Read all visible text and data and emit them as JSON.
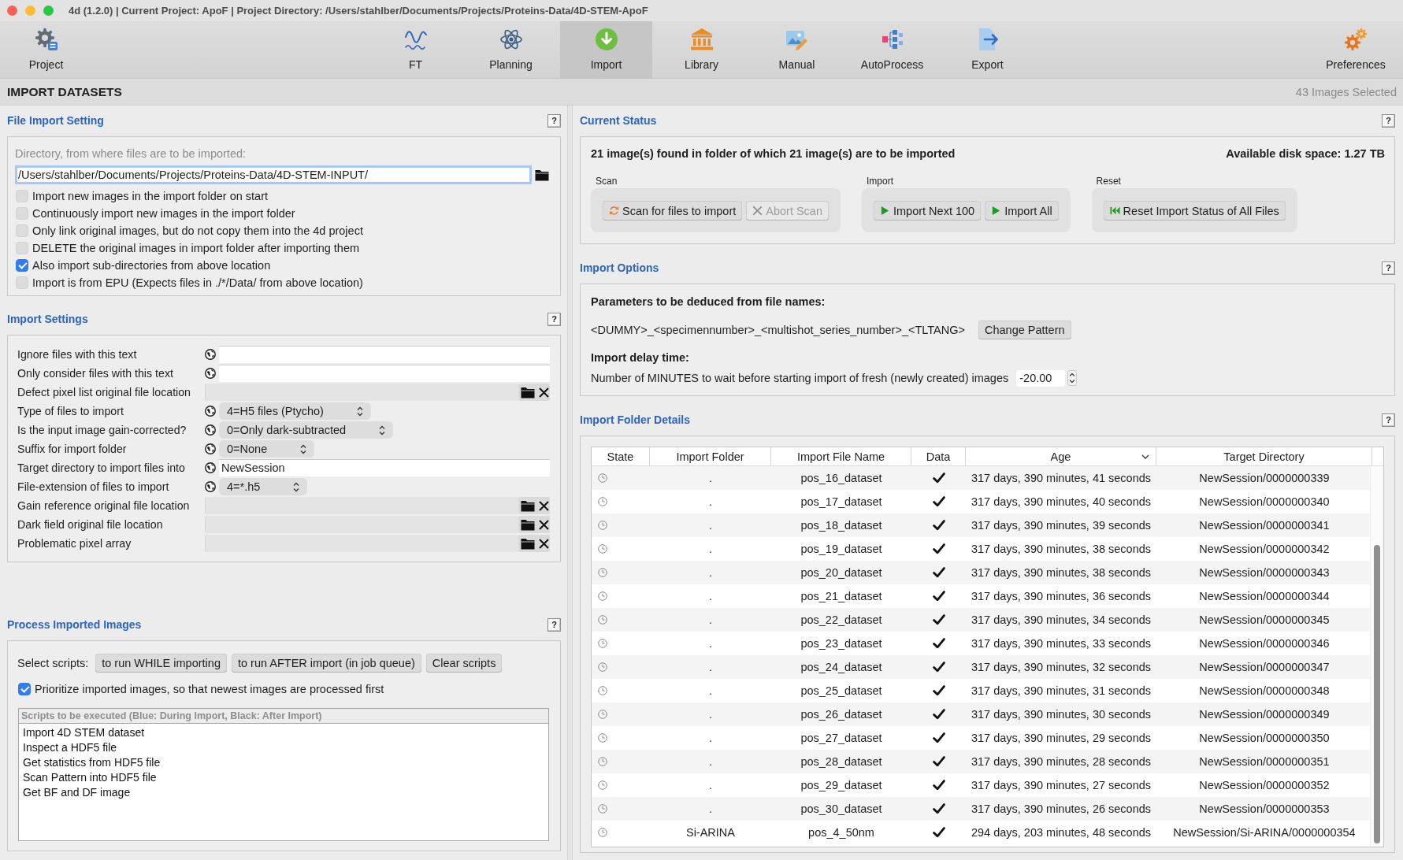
{
  "window": {
    "title": "4d (1.2.0) | Current Project: ApoF | Project Directory: /Users/stahlber/Documents/Projects/Proteins-Data/4D-STEM-ApoF"
  },
  "toolbar": {
    "start": [
      {
        "label": "Project",
        "selected": false
      }
    ],
    "center": [
      {
        "label": "FT",
        "selected": false
      },
      {
        "label": "Planning",
        "selected": false
      },
      {
        "label": "Import",
        "selected": true
      },
      {
        "label": "Library",
        "selected": false
      },
      {
        "label": "Manual",
        "selected": false
      },
      {
        "label": "AutoProcess",
        "selected": false
      },
      {
        "label": "Export",
        "selected": false
      }
    ],
    "end": [
      {
        "label": "Preferences",
        "selected": false
      }
    ]
  },
  "page_header": {
    "title": "IMPORT DATASETS",
    "selection_count": "43 Images Selected"
  },
  "file_import_setting": {
    "title": "File Import Setting",
    "help": "?",
    "directory_label": "Directory, from where files are to be imported:",
    "directory": {
      "value": "/Users/stahlber/Documents/Projects/Proteins-Data/4D-STEM-INPUT/",
      "focused": true
    },
    "options": [
      {
        "label": "Import new images in the import folder on start",
        "checked": false
      },
      {
        "label": "Continuously import new images in the import folder",
        "checked": false
      },
      {
        "label": "Only link original images, but do not copy them into the 4d project",
        "checked": false
      },
      {
        "label": "DELETE the original images in import folder after importing them",
        "checked": false
      },
      {
        "label": "Also import sub-directories from above location",
        "checked": true
      },
      {
        "label": "Import is from EPU (Expects files in ./*/Data/ from above location)",
        "checked": false
      }
    ]
  },
  "import_settings": {
    "title": "Import Settings",
    "help": "?",
    "rows": [
      {
        "label": "Ignore files with this text",
        "kind": "text"
      },
      {
        "label": "Only consider files with this text",
        "kind": "text"
      },
      {
        "label": "Defect pixel list original file location",
        "kind": "file"
      },
      {
        "label": "Type of files to import",
        "kind": "dropdown",
        "value": "4=H5 files (Ptycho)"
      },
      {
        "label": "Is the input image gain-corrected?",
        "kind": "dropdown",
        "value": "0=Only dark-subtracted"
      },
      {
        "label": "Suffix for import folder",
        "kind": "dropdown",
        "value": "0=None"
      },
      {
        "label": "Target directory to import files into",
        "kind": "text",
        "value": "NewSession"
      },
      {
        "label": "File-extension of files to import",
        "kind": "dropdown",
        "value": "4=*.h5"
      },
      {
        "label": "Gain reference original file location",
        "kind": "file"
      },
      {
        "label": "Dark field original file location",
        "kind": "file"
      },
      {
        "label": "Problematic pixel array",
        "kind": "file"
      }
    ]
  },
  "process_imported_images": {
    "title": "Process Imported Images",
    "help": "?",
    "select_label": "Select scripts:",
    "buttons": [
      "to run WHILE importing",
      "to run AFTER import (in job queue)",
      "Clear scripts"
    ],
    "prioritize": {
      "label": "Prioritize imported images, so that newest images are processed first",
      "checked": true
    },
    "scripts_header": "Scripts to be executed (Blue: During Import, Black: After Import)",
    "scripts": [
      {
        "name": "Import 4D STEM dataset",
        "during_import": false
      },
      {
        "name": "Inspect a HDF5 file",
        "during_import": false
      },
      {
        "name": "Get statistics from HDF5 file",
        "during_import": false
      },
      {
        "name": "Scan Pattern into HDF5 file",
        "during_import": false
      },
      {
        "name": "Get BF and DF image",
        "during_import": false
      }
    ]
  },
  "current_status": {
    "title": "Current Status",
    "help": "?",
    "summary": "21 image(s) found in folder of which 21 image(s) are to be imported",
    "disk_space": "Available disk space: 1.27 TB",
    "groups": [
      {
        "label": "Scan",
        "buttons": [
          {
            "label": "Scan for files to import",
            "kind": "scan",
            "disabled": false
          },
          {
            "label": "Abort Scan",
            "kind": "abort",
            "disabled": true
          }
        ]
      },
      {
        "label": "Import",
        "buttons": [
          {
            "label": "Import Next 100",
            "kind": "import",
            "disabled": false
          },
          {
            "label": "Import All",
            "kind": "import",
            "disabled": false
          }
        ]
      },
      {
        "label": "Reset",
        "buttons": [
          {
            "label": "Reset Import Status of All Files",
            "kind": "reset",
            "disabled": false
          }
        ]
      }
    ]
  },
  "import_options": {
    "title": "Import Options",
    "help": "?",
    "pattern_heading": "Parameters to be deduced from file names:",
    "pattern": "<DUMMY>_<specimennumber>_<multishot_series_number>_<TLTANG>",
    "change_pattern_button": "Change Pattern",
    "delay_heading": "Import delay time:",
    "delay_label": "Number of MINUTES to wait before starting import of fresh (newly created) images",
    "delay_value": "-20.00"
  },
  "import_folder_details": {
    "title": "Import Folder Details",
    "help": "?",
    "table": {
      "columns": [
        {
          "label": "State",
          "sorted": false
        },
        {
          "label": "Import Folder",
          "sorted": false
        },
        {
          "label": "Import File Name",
          "sorted": false
        },
        {
          "label": "Data",
          "sorted": false
        },
        {
          "label": "Age",
          "sorted": true
        },
        {
          "label": "Target Directory",
          "sorted": false
        }
      ],
      "rows": [
        {
          "import_folder": ".",
          "file_name": "pos_16_dataset",
          "data": true,
          "age": "317 days, 390 minutes, 41 seconds",
          "target_directory": "NewSession/0000000339"
        },
        {
          "import_folder": ".",
          "file_name": "pos_17_dataset",
          "data": true,
          "age": "317 days, 390 minutes, 40 seconds",
          "target_directory": "NewSession/0000000340"
        },
        {
          "import_folder": ".",
          "file_name": "pos_18_dataset",
          "data": true,
          "age": "317 days, 390 minutes, 39 seconds",
          "target_directory": "NewSession/0000000341"
        },
        {
          "import_folder": ".",
          "file_name": "pos_19_dataset",
          "data": true,
          "age": "317 days, 390 minutes, 38 seconds",
          "target_directory": "NewSession/0000000342"
        },
        {
          "import_folder": ".",
          "file_name": "pos_20_dataset",
          "data": true,
          "age": "317 days, 390 minutes, 38 seconds",
          "target_directory": "NewSession/0000000343"
        },
        {
          "import_folder": ".",
          "file_name": "pos_21_dataset",
          "data": true,
          "age": "317 days, 390 minutes, 36 seconds",
          "target_directory": "NewSession/0000000344"
        },
        {
          "import_folder": ".",
          "file_name": "pos_22_dataset",
          "data": true,
          "age": "317 days, 390 minutes, 34 seconds",
          "target_directory": "NewSession/0000000345"
        },
        {
          "import_folder": ".",
          "file_name": "pos_23_dataset",
          "data": true,
          "age": "317 days, 390 minutes, 33 seconds",
          "target_directory": "NewSession/0000000346"
        },
        {
          "import_folder": ".",
          "file_name": "pos_24_dataset",
          "data": true,
          "age": "317 days, 390 minutes, 32 seconds",
          "target_directory": "NewSession/0000000347"
        },
        {
          "import_folder": ".",
          "file_name": "pos_25_dataset",
          "data": true,
          "age": "317 days, 390 minutes, 31 seconds",
          "target_directory": "NewSession/0000000348"
        },
        {
          "import_folder": ".",
          "file_name": "pos_26_dataset",
          "data": true,
          "age": "317 days, 390 minutes, 30 seconds",
          "target_directory": "NewSession/0000000349"
        },
        {
          "import_folder": ".",
          "file_name": "pos_27_dataset",
          "data": true,
          "age": "317 days, 390 minutes, 29 seconds",
          "target_directory": "NewSession/0000000350"
        },
        {
          "import_folder": ".",
          "file_name": "pos_28_dataset",
          "data": true,
          "age": "317 days, 390 minutes, 28 seconds",
          "target_directory": "NewSession/0000000351"
        },
        {
          "import_folder": ".",
          "file_name": "pos_29_dataset",
          "data": true,
          "age": "317 days, 390 minutes, 27 seconds",
          "target_directory": "NewSession/0000000352"
        },
        {
          "import_folder": ".",
          "file_name": "pos_30_dataset",
          "data": true,
          "age": "317 days, 390 minutes, 26 seconds",
          "target_directory": "NewSession/0000000353"
        },
        {
          "import_folder": "Si-ARINA",
          "file_name": "pos_4_50nm",
          "data": true,
          "age": "294 days, 203 minutes, 48 seconds",
          "target_directory": "NewSession/Si-ARINA/0000000354"
        }
      ]
    }
  }
}
